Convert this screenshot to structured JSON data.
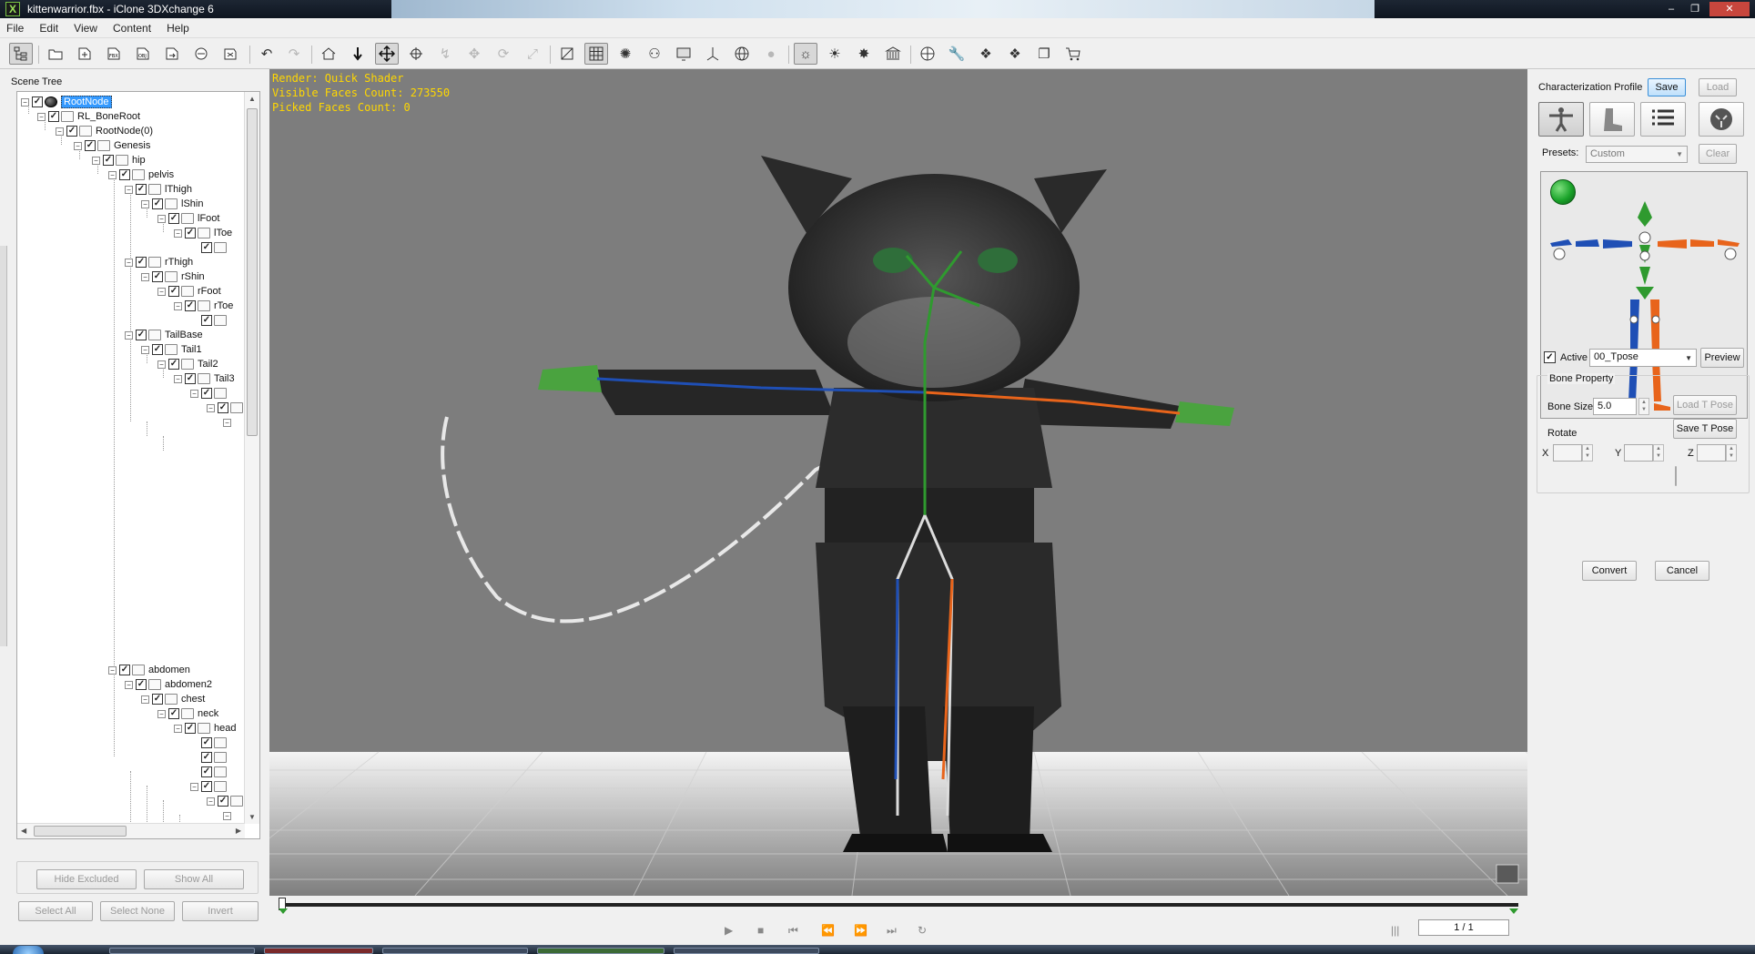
{
  "window": {
    "title": "kittenwarrior.fbx - iClone 3DXchange 6",
    "app_icon_glyph": "X"
  },
  "menu": [
    "File",
    "Edit",
    "View",
    "Content",
    "Help"
  ],
  "scene_tree": {
    "label": "Scene Tree",
    "nodes": [
      {
        "label": "RootNode",
        "selected": true
      },
      {
        "label": "RL_BoneRoot"
      },
      {
        "label": "RootNode(0)"
      },
      {
        "label": "Genesis"
      },
      {
        "label": "hip"
      },
      {
        "label": "pelvis"
      },
      {
        "label": "lThigh"
      },
      {
        "label": "lShin"
      },
      {
        "label": "lFoot"
      },
      {
        "label": "lToe"
      },
      {
        "label": ""
      },
      {
        "label": "rThigh"
      },
      {
        "label": "rShin"
      },
      {
        "label": "rFoot"
      },
      {
        "label": "rToe"
      },
      {
        "label": ""
      },
      {
        "label": "TailBase"
      },
      {
        "label": "Tail1"
      },
      {
        "label": "Tail2"
      },
      {
        "label": "Tail3"
      },
      {
        "label": ""
      },
      {
        "label": ""
      },
      {
        "label": ""
      },
      {
        "label": "abdomen"
      },
      {
        "label": "abdomen2"
      },
      {
        "label": "chest"
      },
      {
        "label": "neck"
      },
      {
        "label": "head"
      },
      {
        "label": ""
      },
      {
        "label": ""
      },
      {
        "label": ""
      },
      {
        "label": ""
      },
      {
        "label": ""
      },
      {
        "label": ""
      }
    ],
    "buttons": {
      "hide_excluded": "Hide Excluded",
      "show_all": "Show All",
      "select_all": "Select All",
      "select_none": "Select None",
      "invert": "Invert"
    }
  },
  "viewport": {
    "render_mode": "Render: Quick Shader",
    "visible_faces": "Visible Faces Count: 273550",
    "picked_faces": "Picked Faces Count: 0",
    "background_color": "#7d7d7d"
  },
  "timeline": {
    "frame": "1 / 1"
  },
  "characterization": {
    "profile_label": "Characterization Profile",
    "save": "Save",
    "load": "Load",
    "presets_label": "Presets:",
    "presets_value": "Custom",
    "clear": "Clear",
    "active_label": "Active",
    "active_checked": true,
    "pose_value": "00_Tpose",
    "preview": "Preview",
    "bone_property_label": "Bone Property",
    "bone_size_label": "Bone Size",
    "bone_size_value": "5.0",
    "load_t_pose": "Load T Pose",
    "save_t_pose": "Save T Pose",
    "rotate_label": "Rotate",
    "rotate_x_label": "X",
    "rotate_y_label": "Y",
    "rotate_z_label": "Z",
    "convert": "Convert",
    "cancel": "Cancel",
    "status_color": "#1aa32a",
    "accent_blue": "#1f4fb5",
    "accent_orange": "#e8641b",
    "accent_green": "#2f9a2f"
  }
}
